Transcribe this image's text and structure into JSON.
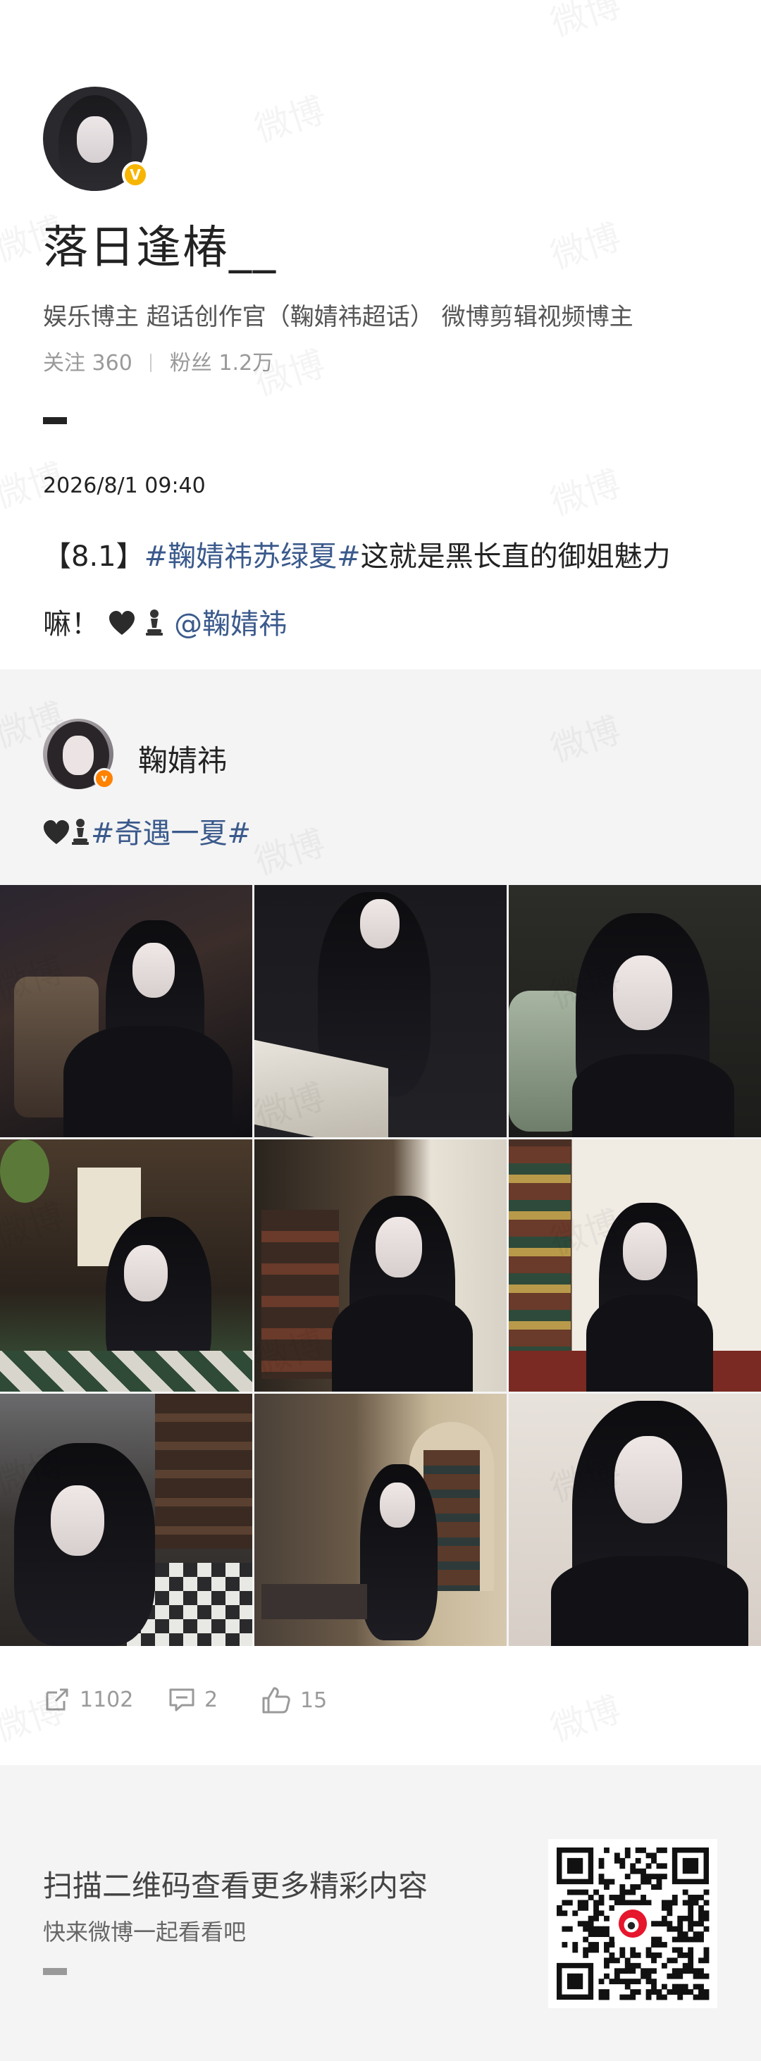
{
  "profile": {
    "username": "落日逢椿__",
    "verified_badge": "V",
    "bio": "娱乐博主  超话创作官（鞠婧祎超话）  微博剪辑视频博主",
    "following_label": "关注",
    "following_count": "360",
    "followers_label": "粉丝",
    "followers_count": "1.2万"
  },
  "post": {
    "timestamp": "2026/8/1  09:40",
    "text_prefix": "【8.1】",
    "topic": "#鞠婧祎苏绿夏#",
    "text_body": "这就是黑长直的御姐魅力嘛！",
    "emojis": [
      "black-heart",
      "chess-pawn"
    ],
    "mention": "@鞠婧祎"
  },
  "repost": {
    "name": "鞠婧祎",
    "badge": "v",
    "emojis": [
      "black-heart",
      "chess-pawn"
    ],
    "topic": "#奇遇一夏#",
    "images": [
      "photo-1",
      "photo-2",
      "photo-3",
      "photo-4",
      "photo-5",
      "photo-6",
      "photo-7",
      "photo-8",
      "photo-9"
    ]
  },
  "actions": {
    "reposts": "1102",
    "comments": "2",
    "likes": "15"
  },
  "footer": {
    "title": "扫描二维码查看更多精彩内容",
    "subtitle": "快来微博一起看看吧"
  },
  "watermark": "微博",
  "colors": {
    "topic_blue": "#3b5a8c",
    "verified_gold": "#f7b500",
    "verified_orange": "#ff8200",
    "muted_gray": "#9a9a9a",
    "panel_gray": "#f4f4f4"
  }
}
